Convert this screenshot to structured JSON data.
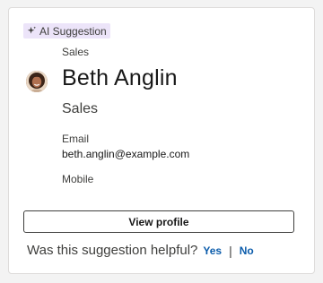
{
  "badge": {
    "icon": "sparkle-icon",
    "label": "AI Suggestion"
  },
  "profile": {
    "top_label": "Sales",
    "name": "Beth Anglin",
    "subtitle": "Sales",
    "email_label": "Email",
    "email_value": "beth.anglin@example.com",
    "mobile_label": "Mobile"
  },
  "actions": {
    "view_profile": "View profile"
  },
  "feedback": {
    "question": "Was this suggestion helpful?",
    "yes": "Yes",
    "separator": "|",
    "no": "No"
  },
  "colors": {
    "badge_bg": "#ece4f9",
    "link": "#0b5cab"
  }
}
